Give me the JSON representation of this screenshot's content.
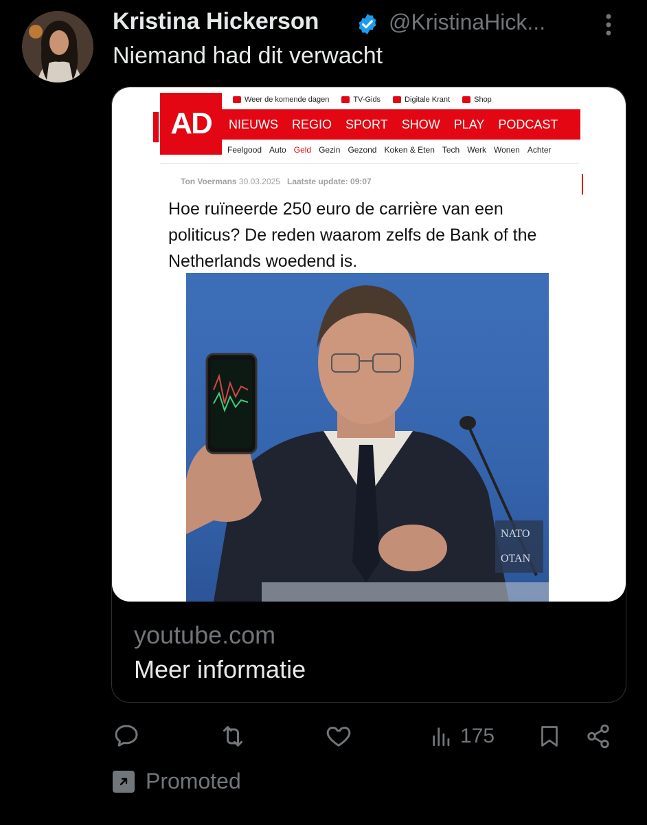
{
  "tweet": {
    "author_name": "Kristina Hickerson",
    "author_handle": "@KristinaHick...",
    "text": "Niemand had dit verwacht",
    "promoted_label": "Promoted"
  },
  "card": {
    "domain": "youtube.com",
    "title": "Meer informatie",
    "image": {
      "logo": "AD",
      "top_links": [
        "Weer de komende dagen",
        "TV-Gids",
        "Digitale Krant",
        "Shop"
      ],
      "main_nav": [
        "NIEUWS",
        "REGIO",
        "SPORT",
        "SHOW",
        "PLAY",
        "PODCAST"
      ],
      "sub_nav": [
        "Feelgood",
        "Auto",
        "Geld",
        "Gezin",
        "Gezond",
        "Koken & Eten",
        "Tech",
        "Werk",
        "Wonen",
        "Achter"
      ],
      "byline_author": "Ton Voermans",
      "byline_date": "30.03.2025",
      "byline_update": "Laatste update: 09:07",
      "headline": "Hoe ruïneerde 250 euro de carrière van een politicus? De reden waarom zelfs de Bank of the Netherlands woedend is.",
      "nato_sign_line1": "NATO",
      "nato_sign_line2": "OTAN"
    }
  },
  "actions": {
    "views_count": "175"
  },
  "icons": {
    "verified": "verified-badge-icon",
    "more": "more-vertical-icon",
    "reply": "reply-icon",
    "retweet": "retweet-icon",
    "like": "heart-icon",
    "views": "views-chart-icon",
    "bookmark": "bookmark-icon",
    "share": "share-icon",
    "promoted": "promoted-arrow-icon"
  },
  "colors": {
    "background": "#000000",
    "text_primary": "#e7e9ea",
    "text_secondary": "#71767b",
    "verified_blue": "#1d9bf0",
    "ad_red": "#e30613"
  }
}
